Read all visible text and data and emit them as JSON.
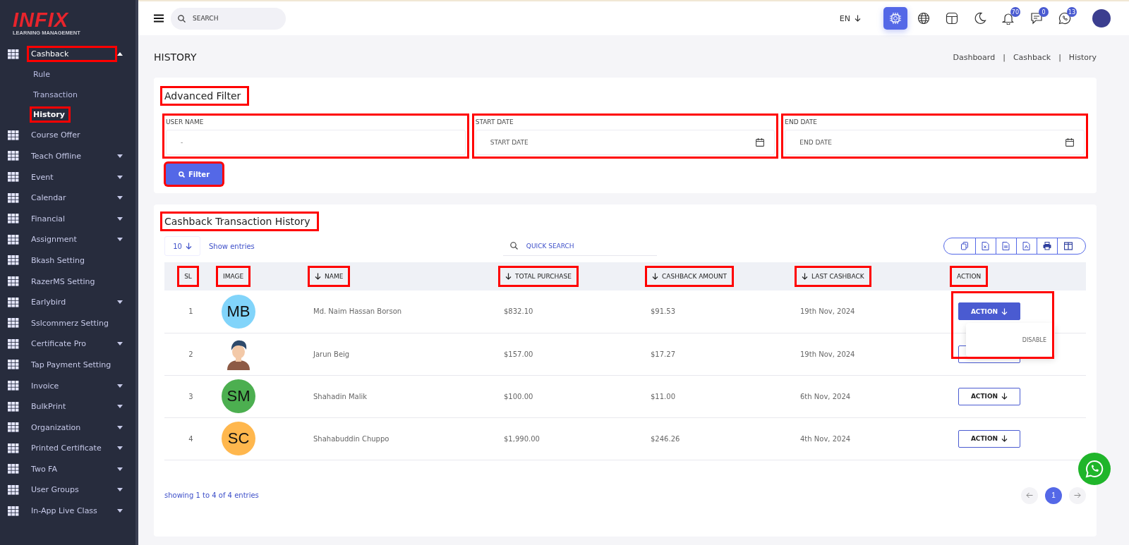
{
  "sidebar": {
    "logo": {
      "brand": "INFIX",
      "tagline": "LEARNING MANAGEMENT"
    },
    "items": [
      {
        "label": "Cashback",
        "expandable": true,
        "expanded": true,
        "highlighted": true,
        "children": [
          {
            "label": "Rule",
            "selected": false,
            "highlighted": false
          },
          {
            "label": "Transaction",
            "selected": false,
            "highlighted": false
          },
          {
            "label": "History",
            "selected": true,
            "highlighted": true
          }
        ]
      },
      {
        "label": "Course Offer",
        "expandable": false,
        "expanded": false,
        "highlighted": false
      },
      {
        "label": "Teach Offline",
        "expandable": true,
        "expanded": false,
        "highlighted": false
      },
      {
        "label": "Event",
        "expandable": true,
        "expanded": false,
        "highlighted": false
      },
      {
        "label": "Calendar",
        "expandable": true,
        "expanded": false,
        "highlighted": false
      },
      {
        "label": "Financial",
        "expandable": true,
        "expanded": false,
        "highlighted": false
      },
      {
        "label": "Assignment",
        "expandable": true,
        "expanded": false,
        "highlighted": false
      },
      {
        "label": "Bkash Setting",
        "expandable": false,
        "expanded": false,
        "highlighted": false
      },
      {
        "label": "RazerMS Setting",
        "expandable": false,
        "expanded": false,
        "highlighted": false
      },
      {
        "label": "Earlybird",
        "expandable": true,
        "expanded": false,
        "highlighted": false
      },
      {
        "label": "Sslcommerz Setting",
        "expandable": false,
        "expanded": false,
        "highlighted": false
      },
      {
        "label": "Certificate Pro",
        "expandable": true,
        "expanded": false,
        "highlighted": false
      },
      {
        "label": "Tap Payment Setting",
        "expandable": false,
        "expanded": false,
        "highlighted": false
      },
      {
        "label": "Invoice",
        "expandable": true,
        "expanded": false,
        "highlighted": false
      },
      {
        "label": "BulkPrint",
        "expandable": true,
        "expanded": false,
        "highlighted": false
      },
      {
        "label": "Organization",
        "expandable": true,
        "expanded": false,
        "highlighted": false
      },
      {
        "label": "Printed Certificate",
        "expandable": true,
        "expanded": false,
        "highlighted": false
      },
      {
        "label": "Two FA",
        "expandable": true,
        "expanded": false,
        "highlighted": false
      },
      {
        "label": "User Groups",
        "expandable": true,
        "expanded": false,
        "highlighted": false
      },
      {
        "label": "In-App Live Class",
        "expandable": true,
        "expanded": false,
        "highlighted": false
      }
    ]
  },
  "topbar": {
    "search": {
      "placeholder": "SEARCH"
    },
    "language": "EN",
    "icons": [
      {
        "kind": "ai",
        "active": true
      },
      {
        "kind": "globe",
        "active": false
      },
      {
        "kind": "layout",
        "active": false
      },
      {
        "kind": "moon",
        "active": false
      },
      {
        "kind": "bell",
        "active": false,
        "badge": "70"
      },
      {
        "kind": "chat",
        "active": false,
        "badge": "0"
      },
      {
        "kind": "whatsapp",
        "active": false,
        "badge": "13"
      }
    ]
  },
  "page": {
    "title": "HISTORY",
    "breadcrumb": [
      "Dashboard",
      "Cashback",
      "History"
    ],
    "breadcrumb_separator": "|"
  },
  "filter": {
    "title": "Advanced Filter",
    "title_highlighted": true,
    "fields": [
      {
        "label": "USER NAME",
        "kind": "select",
        "value": "-",
        "highlighted": true
      },
      {
        "label": "START DATE",
        "kind": "date",
        "placeholder": "START DATE",
        "highlighted": true
      },
      {
        "label": "END DATE",
        "kind": "date",
        "placeholder": "END DATE",
        "highlighted": true
      }
    ],
    "button": {
      "label": "Filter",
      "highlighted": true
    }
  },
  "table_card": {
    "title": "Cashback Transaction History",
    "title_highlighted": true,
    "page_size": "10",
    "show_entries": "Show entries",
    "quick_search": {
      "placeholder": "QUICK SEARCH"
    },
    "export_buttons": [
      {
        "kind": "copy"
      },
      {
        "kind": "excel"
      },
      {
        "kind": "csv"
      },
      {
        "kind": "pdf"
      },
      {
        "kind": "print"
      },
      {
        "kind": "columns"
      }
    ],
    "columns": [
      {
        "label": "SL",
        "sortable": false,
        "highlighted": true
      },
      {
        "label": "IMAGE",
        "sortable": false,
        "highlighted": true
      },
      {
        "label": "NAME",
        "sortable": true,
        "highlighted": true
      },
      {
        "label": "TOTAL PURCHASE",
        "sortable": true,
        "highlighted": true
      },
      {
        "label": "CASHBACK AMOUNT",
        "sortable": true,
        "highlighted": true
      },
      {
        "label": "LAST CASHBACK",
        "sortable": true,
        "highlighted": true
      },
      {
        "label": "ACTION",
        "sortable": false,
        "highlighted": true
      }
    ],
    "rows": [
      {
        "sl": "1",
        "avatar": {
          "kind": "initials",
          "initials": "MB",
          "color": "#81d4fa"
        },
        "name": "Md. Naim Hassan Borson",
        "total_purchase": "$832.10",
        "cashback_amount": "$91.53",
        "last_cashback": "19th Nov, 2024",
        "action": {
          "label": "ACTION",
          "open": true,
          "highlighted": true,
          "menu": [
            "DISABLE"
          ]
        }
      },
      {
        "sl": "2",
        "name": "Jarun Beig",
        "total_purchase": "$157.00",
        "cashback_amount": "$17.27",
        "last_cashback": "19th Nov, 2024",
        "action": {
          "open": false,
          "highlighted": false
        }
      },
      {
        "sl": "3",
        "avatar": {
          "kind": "initials",
          "initials": "SM",
          "color": "#4caf50"
        },
        "name": "Shahadin Malik",
        "total_purchase": "$100.00",
        "cashback_amount": "$11.00",
        "last_cashback": "6th Nov, 2024",
        "action": {
          "label": "ACTION",
          "open": false,
          "highlighted": false
        }
      },
      {
        "sl": "4",
        "avatar": {
          "kind": "initials",
          "initials": "SC",
          "color": "#ffb74d"
        },
        "name": "Shahabuddin Chuppo",
        "total_purchase": "$1,990.00",
        "cashback_amount": "$246.26",
        "last_cashback": "4th Nov, 2024",
        "action": {
          "label": "ACTION",
          "open": false,
          "highlighted": false
        }
      }
    ],
    "footer": "showing 1 to 4 of 4 entries",
    "pagination": [
      {
        "label": "1",
        "selected": true
      }
    ]
  }
}
